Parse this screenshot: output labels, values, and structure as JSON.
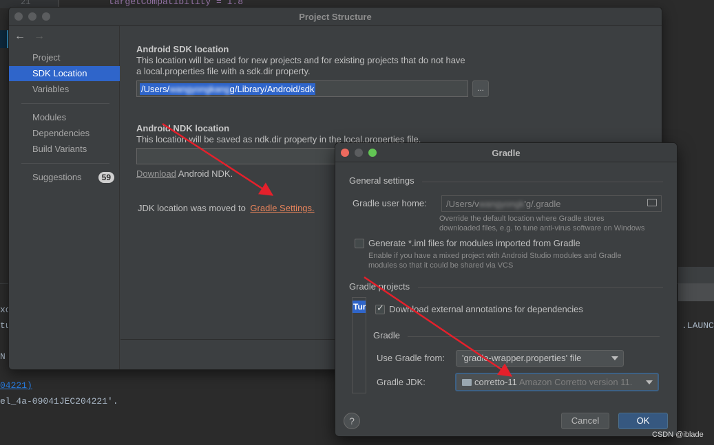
{
  "background": {
    "line_number": "21",
    "code_line": "targetCompatibility = 1.8",
    "console_lines": [
      "xc",
      "tu",
      "N",
      "04221)",
      "el_4a-09041JEC204221'.",
      ".LAUNCH"
    ]
  },
  "project_structure": {
    "title": "Project Structure",
    "nav": {
      "back": "←",
      "forward": "→"
    },
    "sidebar": [
      {
        "label": "Project"
      },
      {
        "label": "SDK Location",
        "selected": true
      },
      {
        "label": "Variables"
      },
      {
        "label": "Modules"
      },
      {
        "label": "Dependencies"
      },
      {
        "label": "Build Variants"
      },
      {
        "label": "Suggestions",
        "badge": "59"
      }
    ],
    "sdk_heading": "Android SDK location",
    "sdk_desc_1": "This location will be used for new projects and for existing projects that do not have",
    "sdk_desc_2": "a local.properties file with a sdk.dir property.",
    "sdk_path_prefix": "/Users/",
    "sdk_path_blur": "wangyongkang",
    "sdk_path_suffix": "g/Library/Android/sdk",
    "browse_label": "...",
    "ndk_heading": "Android NDK location",
    "ndk_desc": "This location will be saved as ndk.dir property in the local.properties file.",
    "download_link": "Download",
    "download_suffix": "Android NDK.",
    "jdk_moved_text": "JDK location was moved to",
    "gradle_settings_link": "Gradle Settings."
  },
  "gradle": {
    "title": "Gradle",
    "general_settings": "General settings",
    "user_home_label": "Gradle user home:",
    "user_home_prefix": "/Users/v",
    "user_home_blur": "wangyongk",
    "user_home_suffix": "'g/.gradle",
    "user_home_hint_1": "Override the default location where Gradle stores",
    "user_home_hint_2": "downloaded files, e.g. to tune anti-virus software on Windows",
    "generate_iml_label": "Generate *.iml files for modules imported from Gradle",
    "generate_iml_checked": false,
    "generate_iml_hint_1": "Enable if you have a mixed project with Android Studio modules and Gradle",
    "generate_iml_hint_2": "modules so that it could be shared via VCS",
    "gradle_projects": "Gradle projects",
    "project_tab": "Tur",
    "download_annotations_label": "Download external annotations for dependencies",
    "download_annotations_checked": true,
    "gradle_group": "Gradle",
    "use_gradle_from_label": "Use Gradle from:",
    "use_gradle_from_value": "'gradle-wrapper.properties' file",
    "gradle_jdk_label": "Gradle JDK:",
    "gradle_jdk_value": "corretto-11",
    "gradle_jdk_desc": "Amazon Corretto version 11.",
    "help_label": "?",
    "cancel_label": "Cancel",
    "ok_label": "OK"
  },
  "watermark": "CSDN @iblade",
  "colors": {
    "selection": "#2f65ca",
    "link_orange": "#e8845b",
    "ok_button": "#365880",
    "annotation_arrow": "#e5202b"
  }
}
